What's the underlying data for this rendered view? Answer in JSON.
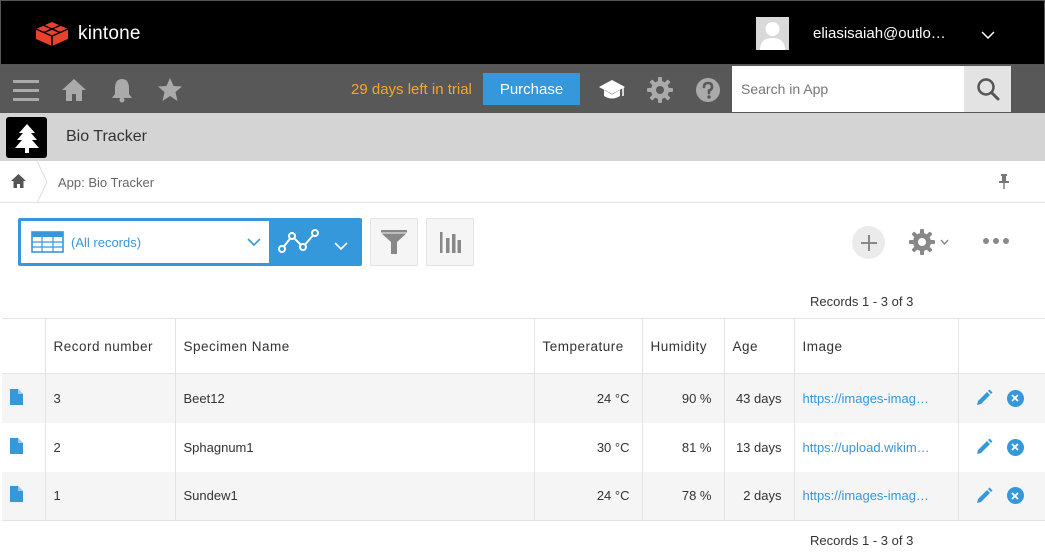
{
  "header": {
    "logo_text": "kintone",
    "user_email": "eliasisaiah@outlo…"
  },
  "toolbar": {
    "trial_text": "29 days left in trial",
    "purchase_label": "Purchase",
    "search_placeholder": "Search in App"
  },
  "app": {
    "title": "Bio Tracker",
    "breadcrumb": "App: Bio Tracker"
  },
  "view": {
    "selected": "(All records)"
  },
  "records": {
    "count_top": "Records 1 - 3 of 3",
    "count_bottom": "Records 1 - 3 of 3",
    "columns": [
      "Record number",
      "Specimen Name",
      "Temperature",
      "Humidity",
      "Age",
      "Image"
    ],
    "rows": [
      {
        "record_number": "3",
        "specimen": "Beet12",
        "temperature": "24 °C",
        "humidity": "90 %",
        "age": "43 days",
        "image": "https://images-imag…"
      },
      {
        "record_number": "2",
        "specimen": "Sphagnum1",
        "temperature": "30 °C",
        "humidity": "81 %",
        "age": "13 days",
        "image": "https://upload.wikim…"
      },
      {
        "record_number": "1",
        "specimen": "Sundew1",
        "temperature": "24 °C",
        "humidity": "78 %",
        "age": "2 days",
        "image": "https://images-imag…"
      }
    ]
  },
  "icons": {
    "logo": "kintone-logo-icon",
    "menu": "hamburger-menu-icon",
    "home": "home-icon",
    "notifications": "bell-icon",
    "favorites": "star-icon",
    "guide": "graduation-cap-icon",
    "settings": "gear-icon",
    "help": "question-icon",
    "search": "search-icon",
    "app": "tree-icon",
    "pin": "pin-icon"
  },
  "colors": {
    "accent": "#3498db",
    "trial": "#f7a530",
    "topbar": "#000000",
    "toolbar": "#585858"
  }
}
